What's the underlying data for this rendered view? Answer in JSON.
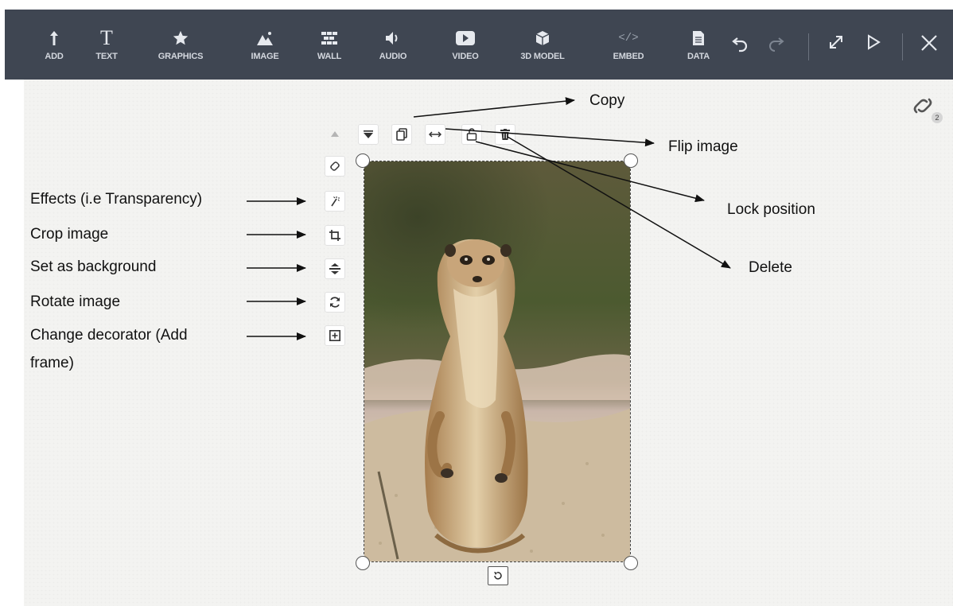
{
  "toolbar": {
    "tools": [
      {
        "label": "ADD",
        "icon": "add-arrow-icon"
      },
      {
        "label": "TEXT",
        "icon": "text-t-icon"
      },
      {
        "label": "GRAPHICS",
        "icon": "star-icon"
      },
      {
        "label": "IMAGE",
        "icon": "image-icon"
      },
      {
        "label": "WALL",
        "icon": "wall-icon"
      },
      {
        "label": "AUDIO",
        "icon": "speaker-icon"
      },
      {
        "label": "VIDEO",
        "icon": "play-icon"
      },
      {
        "label": "3D MODEL",
        "icon": "cube-icon"
      },
      {
        "label": "EMBED",
        "icon": "code-icon"
      },
      {
        "label": "DATA",
        "icon": "document-icon"
      }
    ],
    "text_glyph": "T",
    "embed_glyph": "</>",
    "actions": [
      "undo-icon",
      "redo-icon",
      "expand-icon",
      "play-preview-icon",
      "close-icon"
    ]
  },
  "link_badge": {
    "count": "2"
  },
  "image": {
    "subject": "meerkat photo"
  },
  "annotations": {
    "copy": "Copy",
    "flip": "Flip image",
    "lock": "Lock position",
    "delete": "Delete",
    "effects": "Effects (i.e Transparency)",
    "crop": "Crop image",
    "background": "Set as background",
    "rotate": "Rotate image",
    "decorator_line1": "Change decorator (Add",
    "decorator_line2": "frame)"
  },
  "colors": {
    "toolbar_bg": "#3f4652",
    "canvas_bg": "#f3f3f1",
    "toolbar_text": "#d3d7de"
  }
}
